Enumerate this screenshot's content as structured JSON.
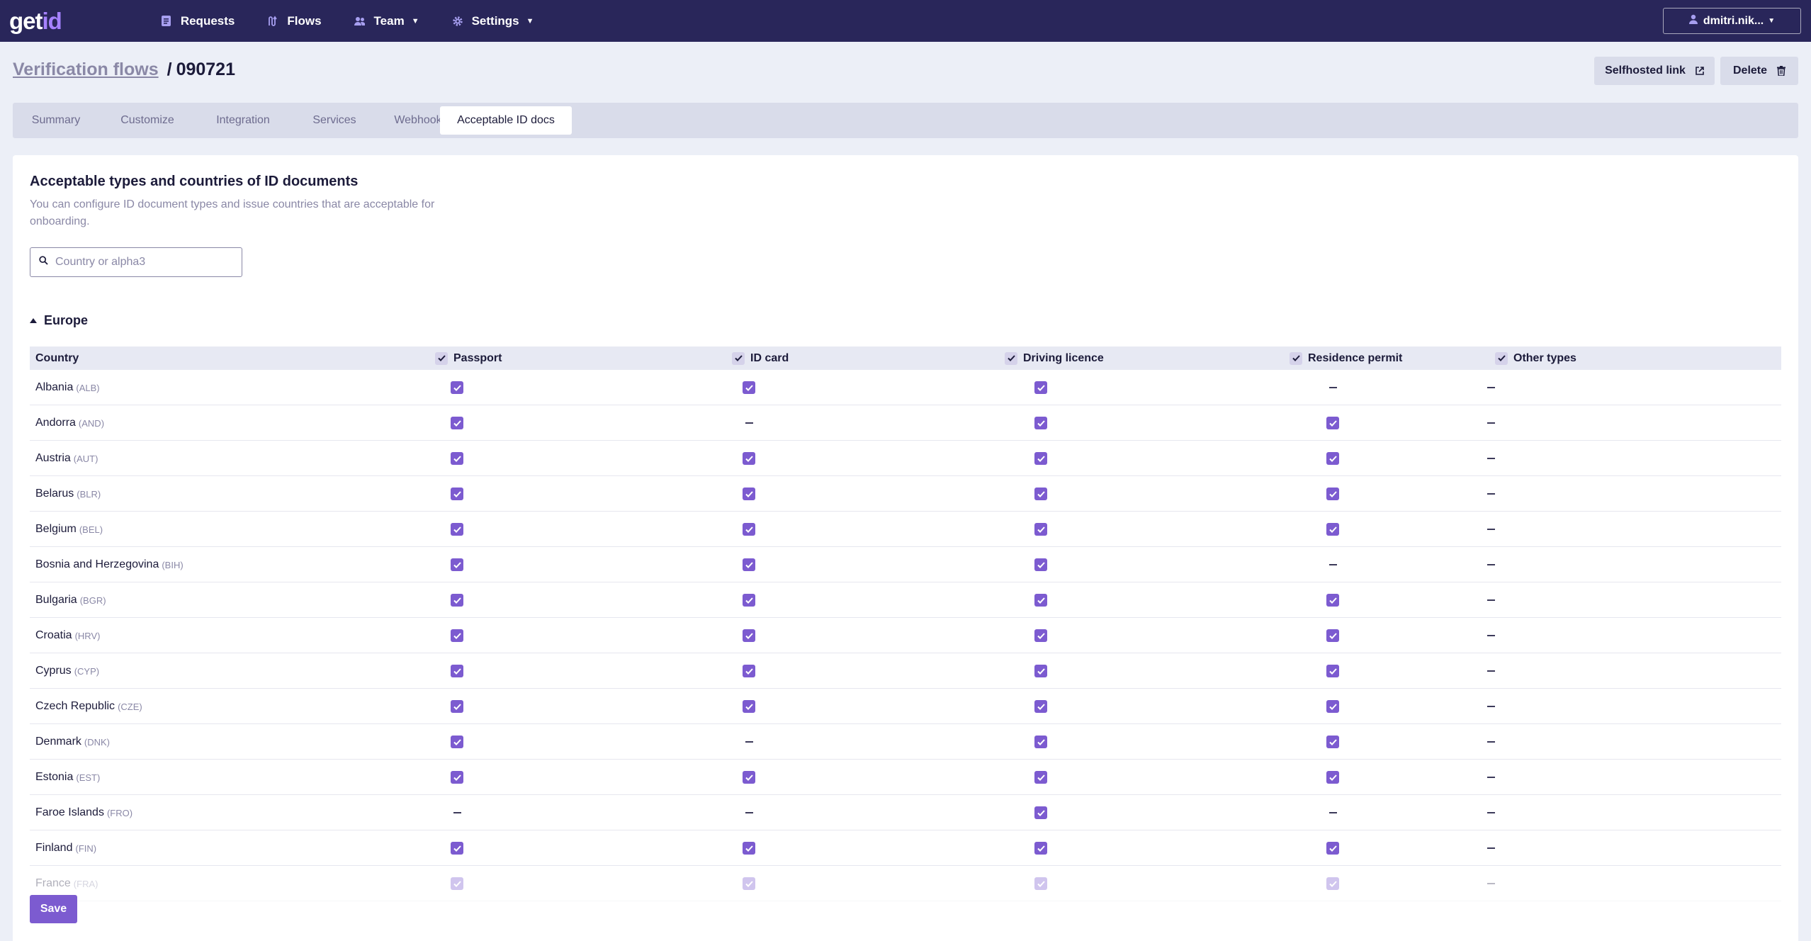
{
  "brand": {
    "logo_part1": "get",
    "logo_part2": "id",
    "accent": "#7c5bd0",
    "nav_bg": "#29265a"
  },
  "nav": {
    "requests": "Requests",
    "flows": "Flows",
    "team": "Team",
    "settings": "Settings",
    "user": "dmitri.nik..."
  },
  "header": {
    "breadcrumb_parent": "Verification flows",
    "breadcrumb_sep": "/",
    "breadcrumb_current": "090721",
    "selfhosted_label": "Selfhosted link",
    "delete_label": "Delete"
  },
  "tabs": [
    "Summary",
    "Customize",
    "Integration",
    "Services",
    "Webhooks",
    "Acceptable ID docs"
  ],
  "active_tab": "Acceptable ID docs",
  "section": {
    "title": "Acceptable types and countries of ID documents",
    "description": "You can configure ID document types and issue countries that are acceptable for onboarding.",
    "search_placeholder": "Country or alpha3",
    "region": "Europe"
  },
  "table": {
    "columns": [
      "Country",
      "Passport",
      "ID card",
      "Driving licence",
      "Residence permit",
      "Other types"
    ],
    "rows": [
      {
        "name": "Albania",
        "code": "(ALB)",
        "values": [
          true,
          true,
          true,
          null,
          null
        ]
      },
      {
        "name": "Andorra",
        "code": "(AND)",
        "values": [
          true,
          null,
          true,
          true,
          null
        ]
      },
      {
        "name": "Austria",
        "code": "(AUT)",
        "values": [
          true,
          true,
          true,
          true,
          null
        ]
      },
      {
        "name": "Belarus",
        "code": "(BLR)",
        "values": [
          true,
          true,
          true,
          true,
          null
        ]
      },
      {
        "name": "Belgium",
        "code": "(BEL)",
        "values": [
          true,
          true,
          true,
          true,
          null
        ]
      },
      {
        "name": "Bosnia and Herzegovina",
        "code": "(BIH)",
        "values": [
          true,
          true,
          true,
          null,
          null
        ]
      },
      {
        "name": "Bulgaria",
        "code": "(BGR)",
        "values": [
          true,
          true,
          true,
          true,
          null
        ]
      },
      {
        "name": "Croatia",
        "code": "(HRV)",
        "values": [
          true,
          true,
          true,
          true,
          null
        ]
      },
      {
        "name": "Cyprus",
        "code": "(CYP)",
        "values": [
          true,
          true,
          true,
          true,
          null
        ]
      },
      {
        "name": "Czech Republic",
        "code": "(CZE)",
        "values": [
          true,
          true,
          true,
          true,
          null
        ]
      },
      {
        "name": "Denmark",
        "code": "(DNK)",
        "values": [
          true,
          null,
          true,
          true,
          null
        ]
      },
      {
        "name": "Estonia",
        "code": "(EST)",
        "values": [
          true,
          true,
          true,
          true,
          null
        ]
      },
      {
        "name": "Faroe Islands",
        "code": "(FRO)",
        "values": [
          null,
          null,
          true,
          null,
          null
        ]
      },
      {
        "name": "Finland",
        "code": "(FIN)",
        "values": [
          true,
          true,
          true,
          true,
          null
        ]
      },
      {
        "name": "France",
        "code": "(FRA)",
        "values": [
          true,
          true,
          true,
          true,
          null
        ]
      }
    ]
  },
  "save_label": "Save"
}
